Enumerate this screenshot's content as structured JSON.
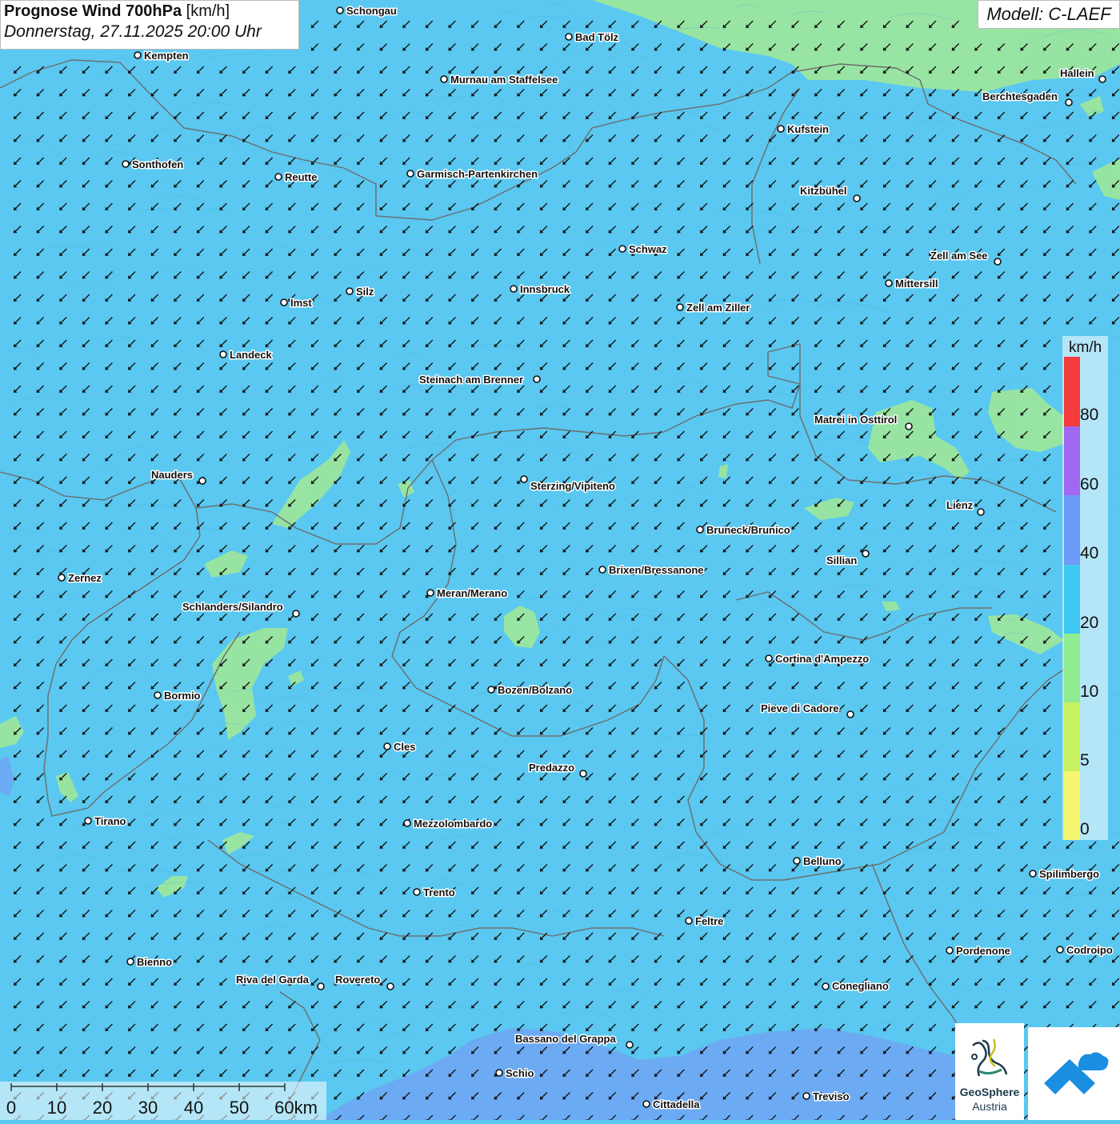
{
  "header": {
    "title_bold": "Prognose Wind 700hPa",
    "title_unit": "[km/h]",
    "datetime": "Donnerstag, 27.11.2025 20:00 Uhr",
    "model": "Modell: C-LAEF"
  },
  "legend": {
    "unit": "km/h",
    "bands": [
      {
        "from": 0,
        "to": 5,
        "color": "#f5f570"
      },
      {
        "from": 5,
        "to": 10,
        "color": "#c8f060"
      },
      {
        "from": 10,
        "to": 20,
        "color": "#90ec90"
      },
      {
        "from": 20,
        "to": 40,
        "color": "#40c8f4"
      },
      {
        "from": 40,
        "to": 60,
        "color": "#6c9cf8"
      },
      {
        "from": 60,
        "to": 80,
        "color": "#a068f0"
      },
      {
        "from": 80,
        "to": 100,
        "color": "#f43c3c"
      }
    ],
    "ticks": [
      "0",
      "5",
      "10",
      "20",
      "40",
      "60",
      "80"
    ]
  },
  "scale_bar": {
    "labels": [
      "0",
      "10",
      "20",
      "30",
      "40",
      "50",
      "60km"
    ]
  },
  "logos": {
    "geosphere_line1": "GeoSphere",
    "geosphere_line2": "Austria"
  },
  "map": {
    "background_color": "#5ac8f0",
    "wind_direction": "northeast",
    "cities": [
      {
        "name": "Schongau"
      },
      {
        "name": "Bad Tölz"
      },
      {
        "name": "Kempten"
      },
      {
        "name": "Murnau am Staffelsee"
      },
      {
        "name": "Hallein"
      },
      {
        "name": "Berchtesgaden"
      },
      {
        "name": "Kufstein"
      },
      {
        "name": "Sonthofen"
      },
      {
        "name": "Reutte"
      },
      {
        "name": "Garmisch-Partenkirchen"
      },
      {
        "name": "Kitzbühel"
      },
      {
        "name": "Schwaz"
      },
      {
        "name": "Zell am See"
      },
      {
        "name": "Mittersill"
      },
      {
        "name": "Silz"
      },
      {
        "name": "Innsbruck"
      },
      {
        "name": "Imst"
      },
      {
        "name": "Zell am Ziller"
      },
      {
        "name": "Landeck"
      },
      {
        "name": "Steinach am Brenner"
      },
      {
        "name": "Matrei in Osttirol"
      },
      {
        "name": "Nauders"
      },
      {
        "name": "Sterzing/Vipiteno"
      },
      {
        "name": "Lienz"
      },
      {
        "name": "Bruneck/Brunico"
      },
      {
        "name": "Sillian"
      },
      {
        "name": "Zernez"
      },
      {
        "name": "Brixen/Bressanone"
      },
      {
        "name": "Meran/Merano"
      },
      {
        "name": "Schlanders/Silandro"
      },
      {
        "name": "Cortina d'Ampezzo"
      },
      {
        "name": "Bozen/Bolzano"
      },
      {
        "name": "Bormio"
      },
      {
        "name": "Pieve di Cadore"
      },
      {
        "name": "Cles"
      },
      {
        "name": "Predazzo"
      },
      {
        "name": "Tirano"
      },
      {
        "name": "Mezzolombardo"
      },
      {
        "name": "Belluno"
      },
      {
        "name": "Spilimbergo"
      },
      {
        "name": "Trento"
      },
      {
        "name": "Feltre"
      },
      {
        "name": "Pordenone"
      },
      {
        "name": "Codroipo"
      },
      {
        "name": "Bienno"
      },
      {
        "name": "Riva del Garda"
      },
      {
        "name": "Rovereto"
      },
      {
        "name": "Conegliano"
      },
      {
        "name": "Bassano del Grappa"
      },
      {
        "name": "Schio"
      },
      {
        "name": "Treviso"
      },
      {
        "name": "Cittadella"
      }
    ]
  }
}
